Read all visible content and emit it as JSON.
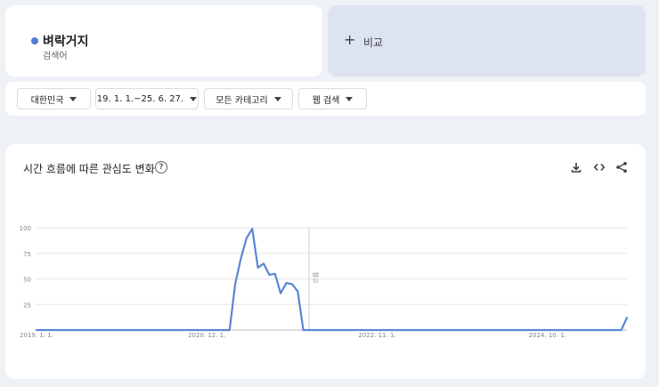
{
  "term": {
    "label": "벼락거지",
    "sublabel": "검색어",
    "color": "#4e7dd6"
  },
  "compare": {
    "label": "비교"
  },
  "filters": [
    {
      "label": "대한민국"
    },
    {
      "label": "19. 1. 1.~25. 6. 27."
    },
    {
      "label": "모든 카테고리"
    },
    {
      "label": "웹 검색"
    }
  ],
  "chart": {
    "title": "시간 흐름에 따른 관심도 변화",
    "note_label": "참고",
    "line_color": "#5b85d6"
  },
  "icons": {
    "help": "help-circle-icon",
    "download": "download-icon",
    "embed": "embed-code-icon",
    "share": "share-icon"
  },
  "chart_data": {
    "type": "line",
    "series": [
      {
        "values": [
          [
            0,
            0
          ],
          [
            34,
            0
          ],
          [
            35,
            45
          ],
          [
            36,
            70
          ],
          [
            37,
            90
          ],
          [
            38,
            99
          ],
          [
            39,
            61
          ],
          [
            40,
            65
          ],
          [
            41,
            54
          ],
          [
            42,
            55
          ],
          [
            43,
            36
          ],
          [
            44,
            46
          ],
          [
            45,
            45
          ],
          [
            46,
            38
          ],
          [
            47,
            0
          ],
          [
            60,
            0
          ],
          [
            100,
            0
          ],
          [
            103,
            0
          ],
          [
            104,
            12
          ]
        ]
      }
    ],
    "x_ticks": [
      {
        "label": "2019. 1. 1.",
        "t": 0
      },
      {
        "label": "2020. 12. 1.",
        "t": 30
      },
      {
        "label": "2022. 11. 1.",
        "t": 60
      },
      {
        "label": "2024. 10. 1.",
        "t": 90
      }
    ],
    "y_ticks": [
      100,
      75,
      50,
      25
    ],
    "ylim": [
      0,
      100
    ],
    "note_x": 48,
    "grid": true
  }
}
